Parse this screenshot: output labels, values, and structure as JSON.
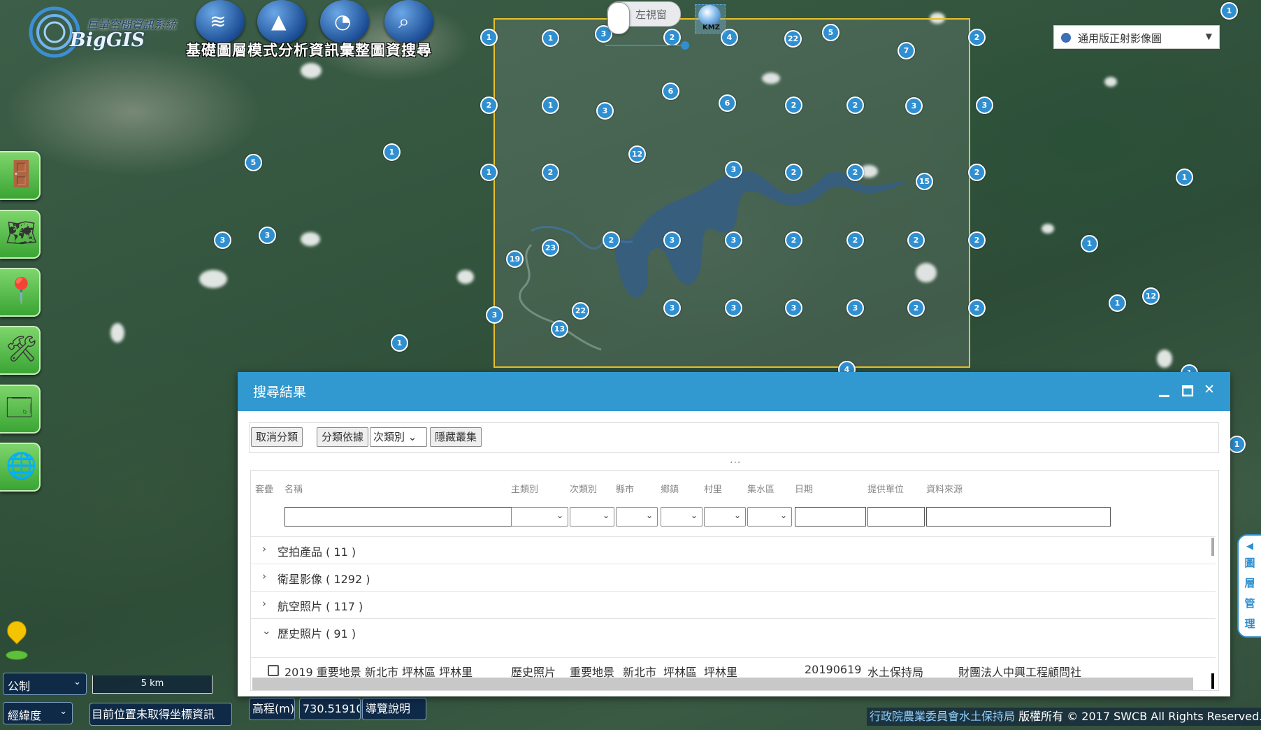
{
  "app": {
    "logo_text": "BigGIS",
    "system_name": "巨量空間資訊系統",
    "toolbar_label": "基礎圖層模式分析資訊彙整圖資搜尋"
  },
  "toolbar": {
    "left_window_toggle": "左視窗",
    "kmz_label": "KMZ"
  },
  "basemap": {
    "selected": "通用版正射影像圖"
  },
  "map": {
    "cluster_counts": [
      "1",
      "1",
      "3",
      "2",
      "4",
      "22",
      "5",
      "7",
      "2",
      "1",
      "2",
      "1",
      "3",
      "6",
      "6",
      "2",
      "2",
      "3",
      "3",
      "1",
      "5",
      "12",
      "1",
      "2",
      "3",
      "2",
      "2",
      "15",
      "2",
      "1",
      "3",
      "3",
      "1",
      "2",
      "3",
      "3",
      "2",
      "2",
      "2",
      "2",
      "1",
      "23",
      "19",
      "3",
      "22",
      "13",
      "3",
      "3",
      "3",
      "3",
      "2",
      "2",
      "1",
      "12",
      "1",
      "4",
      "1"
    ]
  },
  "bottom": {
    "units_selected": "公制",
    "coord_selected": "經緯度",
    "scale_label": "5 km",
    "coord_status": "目前位置未取得坐標資訊",
    "elevation_label": "高程(m)",
    "elevation_value": "730.519106",
    "guide_button": "導覽說明",
    "copyright_org": "行政院農業委員會水土保持局",
    "copyright_text": " 版權所有 © 2017 SWCB All Rights Reserved."
  },
  "layer_tab": {
    "arrow": "◀",
    "label": "圖層管理"
  },
  "panel": {
    "title": "搜尋結果",
    "buttons": {
      "cancel_group": "取消分類",
      "group_by": "分類依據",
      "group_field": "次類別",
      "hide_cluster": "隱藏叢集"
    },
    "splitter": "...",
    "columns": [
      "套疊",
      "名稱",
      "主類別",
      "次類別",
      "縣市",
      "鄉鎮",
      "村里",
      "集水區",
      "日期",
      "提供單位",
      "資料來源"
    ],
    "groups": [
      {
        "name": "空拍產品 ( 11 )",
        "expanded": false
      },
      {
        "name": "衛星影像 ( 1292 )",
        "expanded": false
      },
      {
        "name": "航空照片 ( 117 )",
        "expanded": false
      },
      {
        "name": "歷史照片 ( 91 )",
        "expanded": true
      }
    ],
    "rows": [
      {
        "name": "2019 重要地景 新北市 坪林區 坪林里",
        "main_category": "歷史照片",
        "sub_category": "重要地景",
        "county": "新北市",
        "town": "坪林區",
        "village": "坪林里",
        "watershed": "",
        "date": "20190619",
        "provider": "水土保持局",
        "source": "財團法人中興工程顧問社"
      }
    ]
  }
}
